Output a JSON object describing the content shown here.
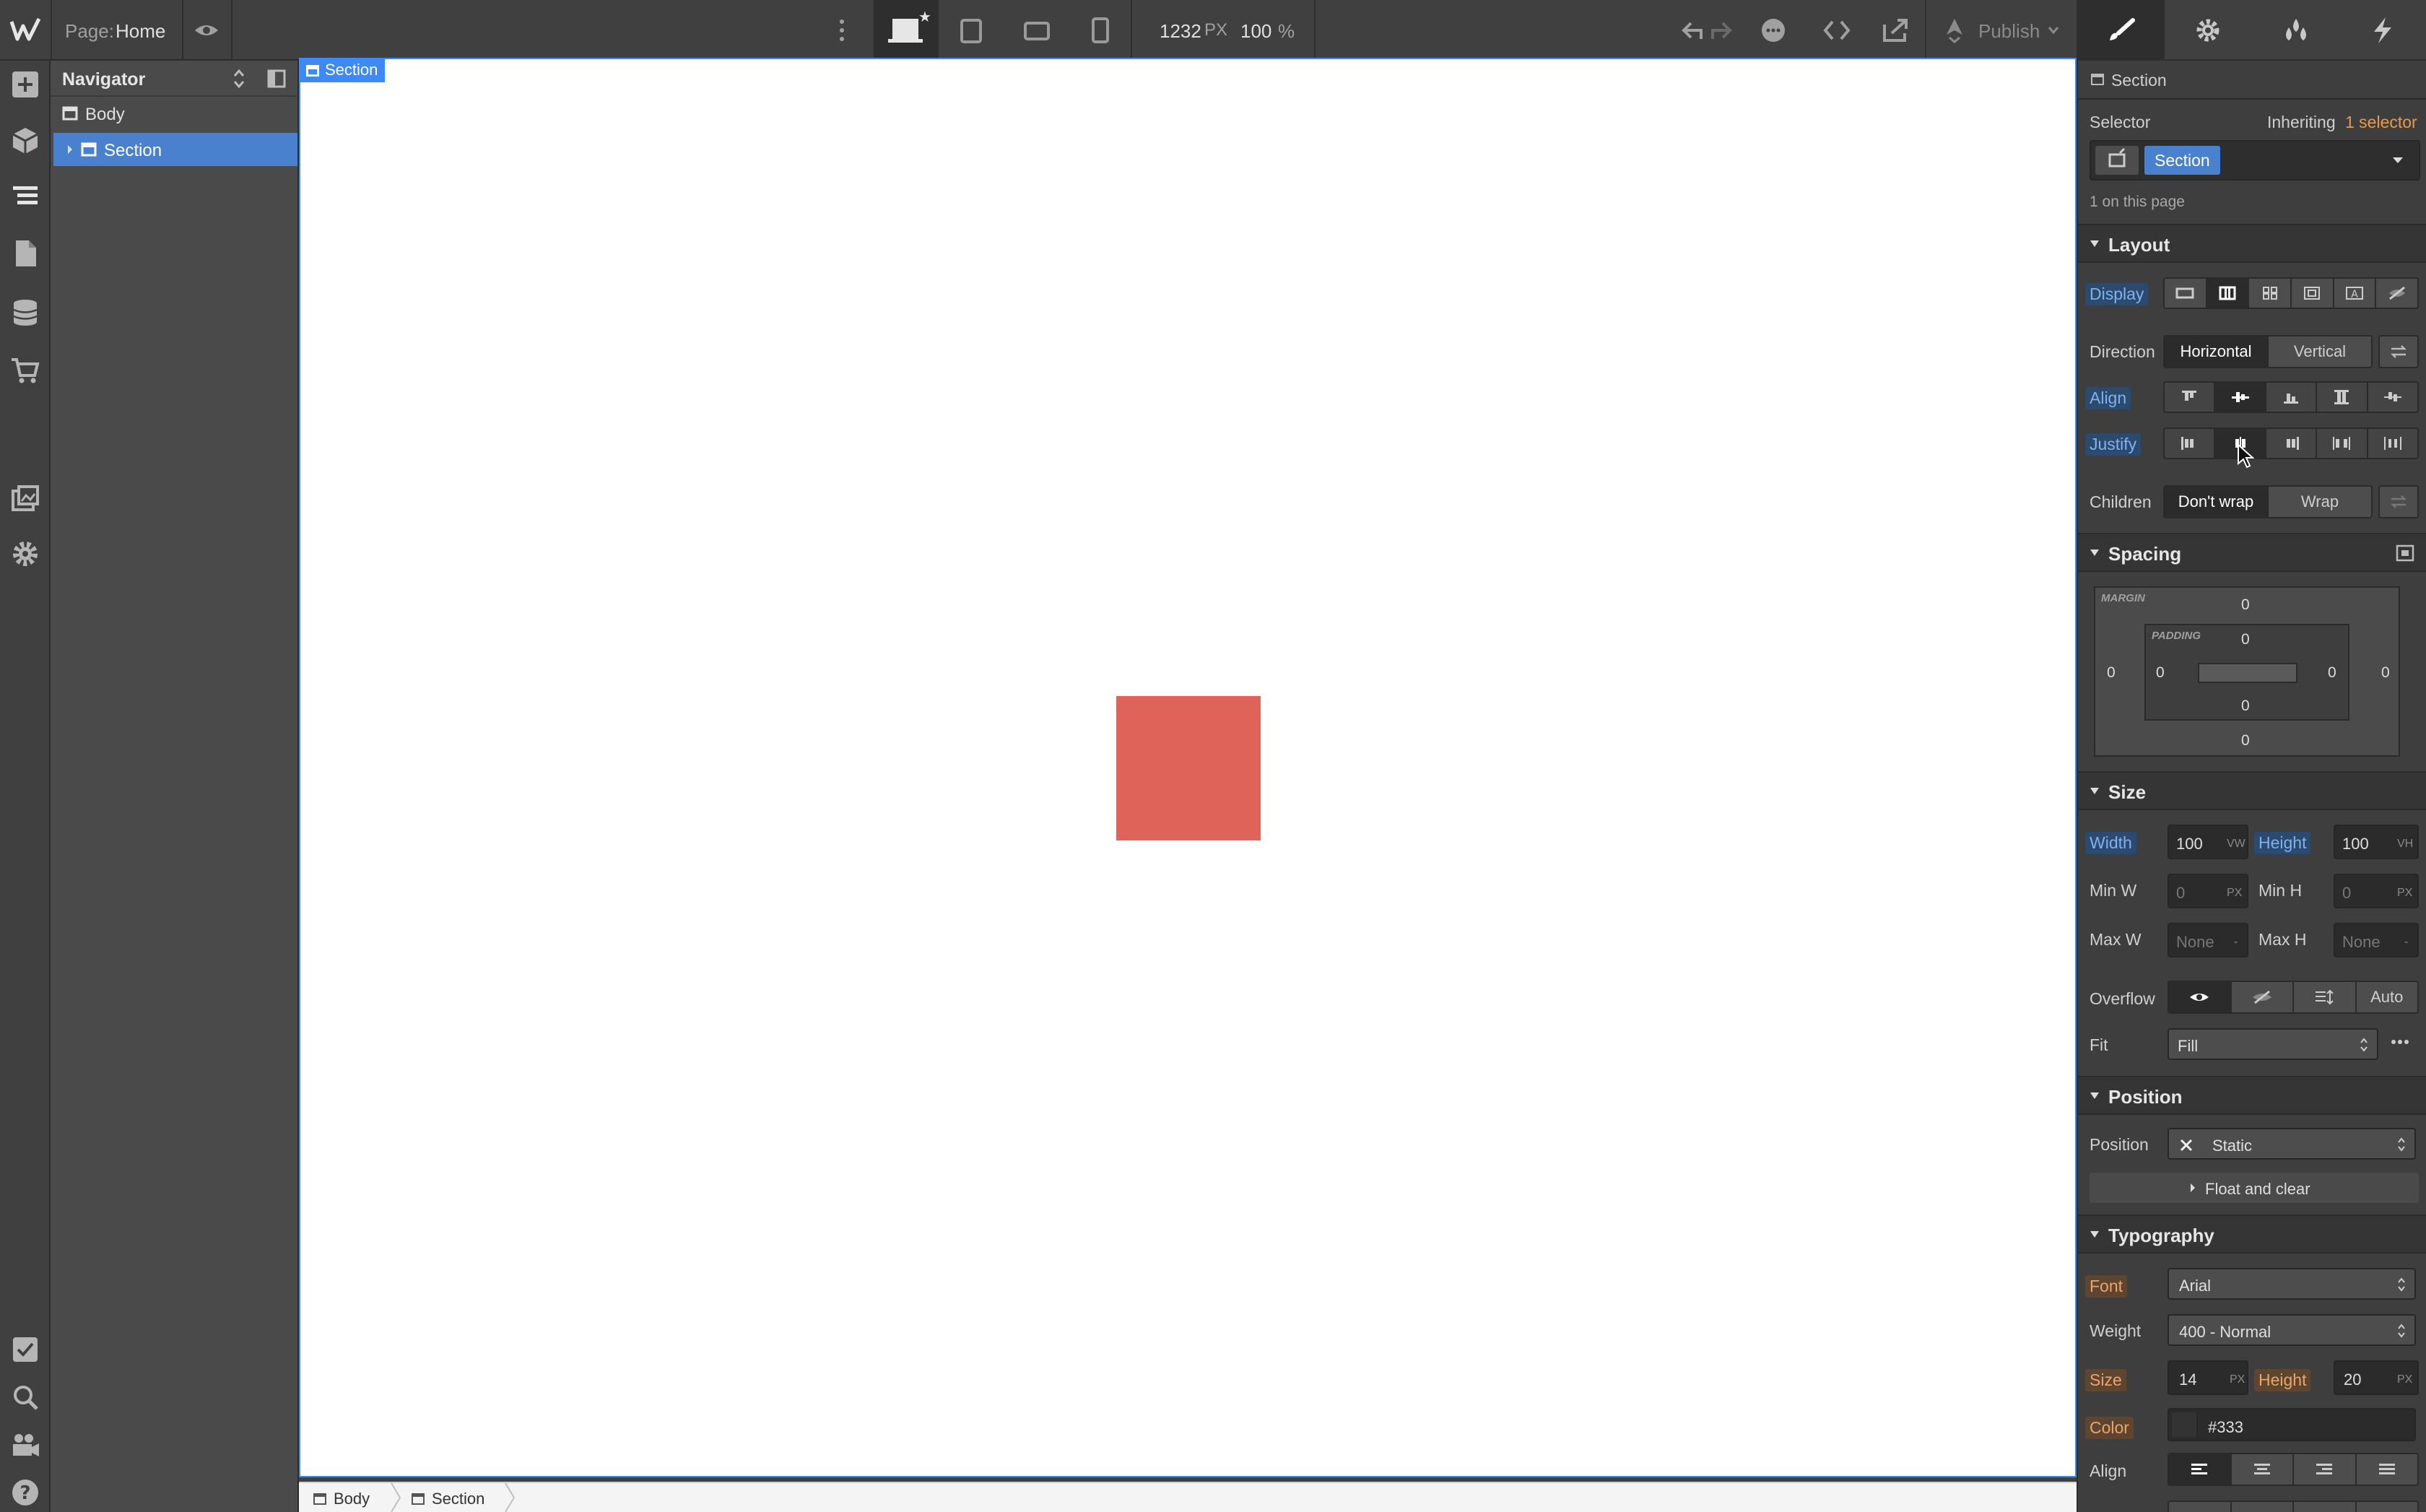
{
  "topbar": {
    "page_label": "Page:",
    "page_name": "Home",
    "width_value": "1232",
    "width_unit": "PX",
    "zoom_value": "100",
    "zoom_unit": "%",
    "publish_label": "Publish"
  },
  "navigator": {
    "title": "Navigator",
    "items": [
      {
        "label": "Body"
      },
      {
        "label": "Section"
      }
    ]
  },
  "canvas": {
    "selection_label": "Section",
    "box_color": "#e0635a"
  },
  "breadcrumbs": [
    "Body",
    "Section"
  ],
  "panel": {
    "element_name": "Section",
    "selector_label": "Selector",
    "inheriting_text": "Inheriting",
    "inheriting_link": "1 selector",
    "selector_chip": "Section",
    "on_page_text": "1 on this page",
    "layout": {
      "title": "Layout",
      "display_label": "Display",
      "direction_label": "Direction",
      "direction_options": [
        "Horizontal",
        "Vertical"
      ],
      "align_label": "Align",
      "justify_label": "Justify",
      "children_label": "Children",
      "children_options": [
        "Don't wrap",
        "Wrap"
      ]
    },
    "spacing": {
      "title": "Spacing",
      "margin_label": "MARGIN",
      "padding_label": "PADDING",
      "margin": {
        "top": "0",
        "right": "0",
        "bottom": "0",
        "left": "0"
      },
      "padding": {
        "top": "0",
        "right": "0",
        "bottom": "0",
        "left": "0"
      }
    },
    "size": {
      "title": "Size",
      "width_label": "Width",
      "width_value": "100",
      "width_unit": "VW",
      "height_label": "Height",
      "height_value": "100",
      "height_unit": "VH",
      "minw_label": "Min W",
      "minw_value": "0",
      "minw_unit": "PX",
      "minh_label": "Min H",
      "minh_value": "0",
      "minh_unit": "PX",
      "maxw_label": "Max W",
      "maxw_value": "None",
      "maxw_unit": "-",
      "maxh_label": "Max H",
      "maxh_value": "None",
      "maxh_unit": "-",
      "overflow_label": "Overflow",
      "overflow_auto": "Auto",
      "fit_label": "Fit",
      "fit_value": "Fill"
    },
    "position": {
      "title": "Position",
      "position_label": "Position",
      "position_value": "Static",
      "float_clear": "Float and clear"
    },
    "typography": {
      "title": "Typography",
      "font_label": "Font",
      "font_value": "Arial",
      "weight_label": "Weight",
      "weight_value": "400 - Normal",
      "size_label": "Size",
      "size_value": "14",
      "size_unit": "PX",
      "height_label": "Height",
      "height_value": "20",
      "height_unit": "PX",
      "color_label": "Color",
      "color_value": "#333",
      "align_label": "Align"
    }
  }
}
